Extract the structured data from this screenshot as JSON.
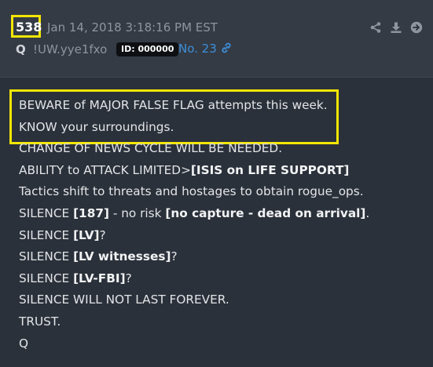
{
  "post": {
    "number": "538",
    "timestamp": "Jan 14, 2018 3:18:16 PM EST",
    "author": "Q",
    "tripcode": "!UW.yye1fxo",
    "id_label": "ID: 000000",
    "post_link": "No. 23",
    "highlight_color": "#f3e600",
    "link_color": "#3d8fd9"
  },
  "actions": {
    "icons": [
      "share-icon",
      "download-icon",
      "arrow-right-circle-icon"
    ]
  },
  "body": {
    "lines": [
      {
        "segments": [
          {
            "text": "BEWARE of MAJOR FALSE FLAG attempts this week."
          }
        ]
      },
      {
        "segments": [
          {
            "text": "KNOW your surroundings."
          }
        ]
      },
      {
        "segments": [
          {
            "text": "CHANGE OF NEWS CYCLE WILL BE NEEDED."
          }
        ]
      },
      {
        "segments": [
          {
            "text": "ABILITY to ATTACK LIMITED>"
          },
          {
            "text": "[ISIS on LIFE SUPPORT]"
          }
        ]
      },
      {
        "segments": [
          {
            "text": "Tactics shift to threats and hostages to obtain rogue_ops."
          }
        ]
      },
      {
        "segments": [
          {
            "text": "SILENCE "
          },
          {
            "text": "[187]"
          },
          {
            "text": " - no risk "
          },
          {
            "text": "[no capture - dead on arrival]"
          },
          {
            "text": "."
          }
        ]
      },
      {
        "segments": [
          {
            "text": "SILENCE "
          },
          {
            "text": "[LV]"
          },
          {
            "text": "?"
          }
        ]
      },
      {
        "segments": [
          {
            "text": "SILENCE "
          },
          {
            "text": "[LV witnesses]"
          },
          {
            "text": "?"
          }
        ]
      },
      {
        "segments": [
          {
            "text": "SILENCE "
          },
          {
            "text": "[LV-FBI]"
          },
          {
            "text": "?"
          }
        ]
      },
      {
        "segments": [
          {
            "text": "SILENCE WILL NOT LAST FOREVER."
          }
        ]
      },
      {
        "segments": [
          {
            "text": "TRUST."
          }
        ]
      },
      {
        "segments": [
          {
            "text": "Q"
          }
        ]
      }
    ]
  }
}
